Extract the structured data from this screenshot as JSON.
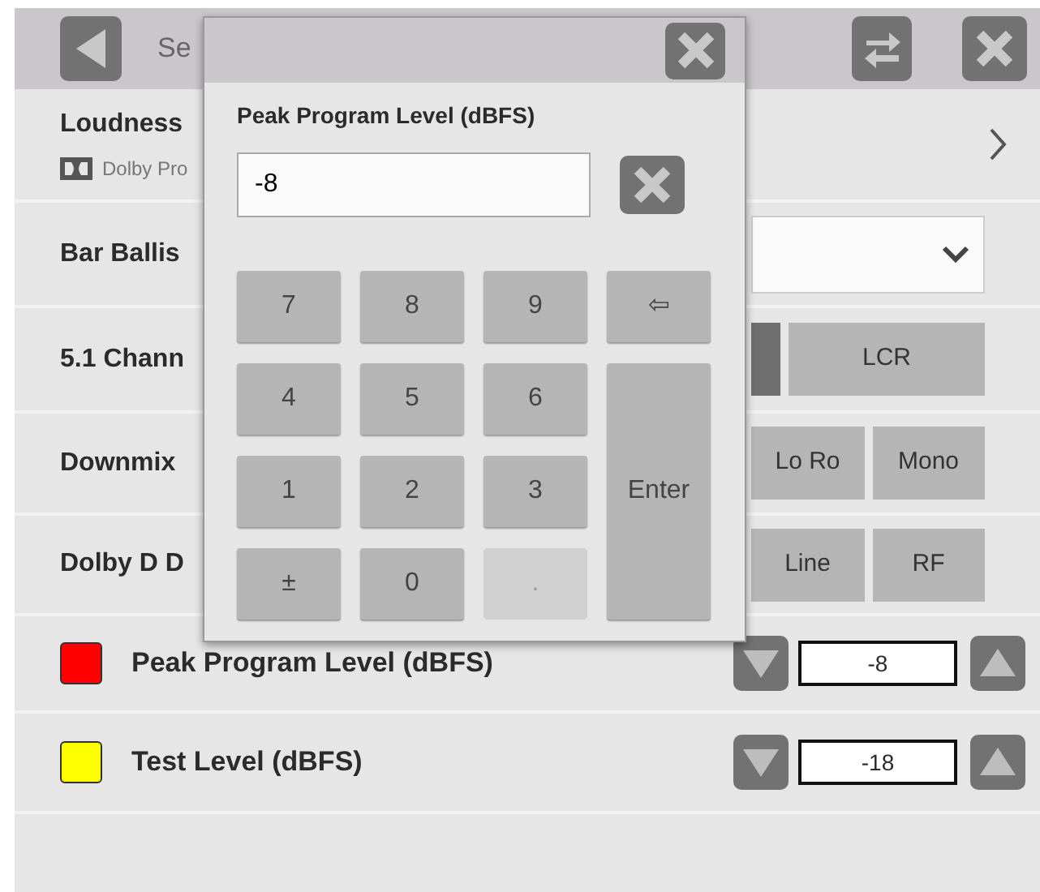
{
  "header": {
    "title": "Se"
  },
  "settings": [
    {
      "label": "Loudness",
      "sublabel": "Dolby Pro",
      "kind": "link"
    },
    {
      "label": "Bar Ballis",
      "kind": "dropdown"
    },
    {
      "label": "5.1 Chann",
      "kind": "segments",
      "options": [
        {
          "selected": true
        },
        {
          "label": "LCR",
          "selected": false
        }
      ]
    },
    {
      "label": "Downmix",
      "kind": "segments",
      "options": [
        {
          "label": "Lo Ro",
          "selected": false
        },
        {
          "label": "Mono",
          "selected": false
        }
      ]
    },
    {
      "label": "Dolby D D",
      "kind": "segments",
      "options": [
        {
          "label": "Line",
          "selected": false
        },
        {
          "label": "RF",
          "selected": false
        }
      ]
    }
  ],
  "levels": [
    {
      "label": "Peak Program Level (dBFS)",
      "color": "#ff0000",
      "value": "-8"
    },
    {
      "label": "Test Level (dBFS)",
      "color": "#ffff00",
      "value": "-18"
    }
  ],
  "keypad": {
    "title": "Peak Program Level (dBFS)",
    "value": "-8",
    "keys": [
      {
        "label": "7",
        "kind": "key",
        "disabled": false
      },
      {
        "label": "8",
        "kind": "key",
        "disabled": false
      },
      {
        "label": "9",
        "kind": "key",
        "disabled": false
      },
      {
        "label": "⇦",
        "kind": "key",
        "disabled": false
      },
      {
        "label": "4",
        "kind": "key",
        "disabled": false
      },
      {
        "label": "5",
        "kind": "key",
        "disabled": false
      },
      {
        "label": "6",
        "kind": "key",
        "disabled": false
      },
      {
        "label": "1",
        "kind": "key",
        "disabled": false
      },
      {
        "label": "2",
        "kind": "key",
        "disabled": false
      },
      {
        "label": "3",
        "kind": "key",
        "disabled": false
      },
      {
        "label": "Enter",
        "kind": "tall",
        "disabled": false
      },
      {
        "label": "±",
        "kind": "key",
        "disabled": false
      },
      {
        "label": "0",
        "kind": "key",
        "disabled": false
      },
      {
        "label": ".",
        "kind": "key",
        "disabled": true
      }
    ]
  }
}
